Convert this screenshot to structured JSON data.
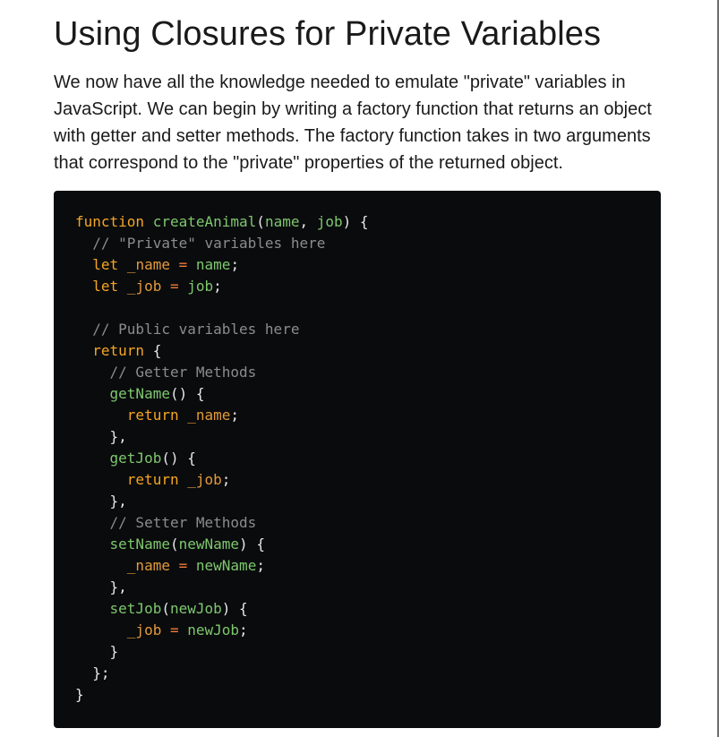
{
  "article": {
    "title": "Using Closures for Private Variables",
    "intro": "We now have all the knowledge needed to emulate \"private\" variables in JavaScript. We can begin by writing a factory function that returns an object with getter and setter methods. The factory function takes in two arguments that correspond to the \"private\" properties of the returned object."
  },
  "code": {
    "language": "javascript",
    "colors": {
      "background": "#0a0b0d",
      "keyword": "#f5a623",
      "function": "#7ec86e",
      "operator": "#f07a3a",
      "comment": "#8c8c8c",
      "variable": "#e39a3b",
      "text": "#e8e8e8"
    },
    "lines": [
      [
        [
          "kw",
          "function"
        ],
        [
          "tx",
          " "
        ],
        [
          "fn",
          "createAnimal"
        ],
        [
          "tx",
          "("
        ],
        [
          "pr",
          "name"
        ],
        [
          "tx",
          ", "
        ],
        [
          "pr",
          "job"
        ],
        [
          "tx",
          ") {"
        ]
      ],
      [
        [
          "tx",
          "  "
        ],
        [
          "cm",
          "// \"Private\" variables here"
        ]
      ],
      [
        [
          "tx",
          "  "
        ],
        [
          "kw",
          "let"
        ],
        [
          "tx",
          " "
        ],
        [
          "vr",
          "_name"
        ],
        [
          "tx",
          " "
        ],
        [
          "op",
          "="
        ],
        [
          "tx",
          " "
        ],
        [
          "pr",
          "name"
        ],
        [
          "tx",
          ";"
        ]
      ],
      [
        [
          "tx",
          "  "
        ],
        [
          "kw",
          "let"
        ],
        [
          "tx",
          " "
        ],
        [
          "vr",
          "_job"
        ],
        [
          "tx",
          " "
        ],
        [
          "op",
          "="
        ],
        [
          "tx",
          " "
        ],
        [
          "pr",
          "job"
        ],
        [
          "tx",
          ";"
        ]
      ],
      [
        [
          "tx",
          ""
        ]
      ],
      [
        [
          "tx",
          "  "
        ],
        [
          "cm",
          "// Public variables here"
        ]
      ],
      [
        [
          "tx",
          "  "
        ],
        [
          "kw",
          "return"
        ],
        [
          "tx",
          " {"
        ]
      ],
      [
        [
          "tx",
          "    "
        ],
        [
          "cm",
          "// Getter Methods"
        ]
      ],
      [
        [
          "tx",
          "    "
        ],
        [
          "fn",
          "getName"
        ],
        [
          "tx",
          "() {"
        ]
      ],
      [
        [
          "tx",
          "      "
        ],
        [
          "kw",
          "return"
        ],
        [
          "tx",
          " "
        ],
        [
          "vr",
          "_name"
        ],
        [
          "tx",
          ";"
        ]
      ],
      [
        [
          "tx",
          "    },"
        ]
      ],
      [
        [
          "tx",
          "    "
        ],
        [
          "fn",
          "getJob"
        ],
        [
          "tx",
          "() {"
        ]
      ],
      [
        [
          "tx",
          "      "
        ],
        [
          "kw",
          "return"
        ],
        [
          "tx",
          " "
        ],
        [
          "vr",
          "_job"
        ],
        [
          "tx",
          ";"
        ]
      ],
      [
        [
          "tx",
          "    },"
        ]
      ],
      [
        [
          "tx",
          "    "
        ],
        [
          "cm",
          "// Setter Methods"
        ]
      ],
      [
        [
          "tx",
          "    "
        ],
        [
          "fn",
          "setName"
        ],
        [
          "tx",
          "("
        ],
        [
          "pr",
          "newName"
        ],
        [
          "tx",
          ") {"
        ]
      ],
      [
        [
          "tx",
          "      "
        ],
        [
          "vr",
          "_name"
        ],
        [
          "tx",
          " "
        ],
        [
          "op",
          "="
        ],
        [
          "tx",
          " "
        ],
        [
          "pr",
          "newName"
        ],
        [
          "tx",
          ";"
        ]
      ],
      [
        [
          "tx",
          "    },"
        ]
      ],
      [
        [
          "tx",
          "    "
        ],
        [
          "fn",
          "setJob"
        ],
        [
          "tx",
          "("
        ],
        [
          "pr",
          "newJob"
        ],
        [
          "tx",
          ") {"
        ]
      ],
      [
        [
          "tx",
          "      "
        ],
        [
          "vr",
          "_job"
        ],
        [
          "tx",
          " "
        ],
        [
          "op",
          "="
        ],
        [
          "tx",
          " "
        ],
        [
          "pr",
          "newJob"
        ],
        [
          "tx",
          ";"
        ]
      ],
      [
        [
          "tx",
          "    }"
        ]
      ],
      [
        [
          "tx",
          "  };"
        ]
      ],
      [
        [
          "tx",
          "}"
        ]
      ]
    ]
  }
}
